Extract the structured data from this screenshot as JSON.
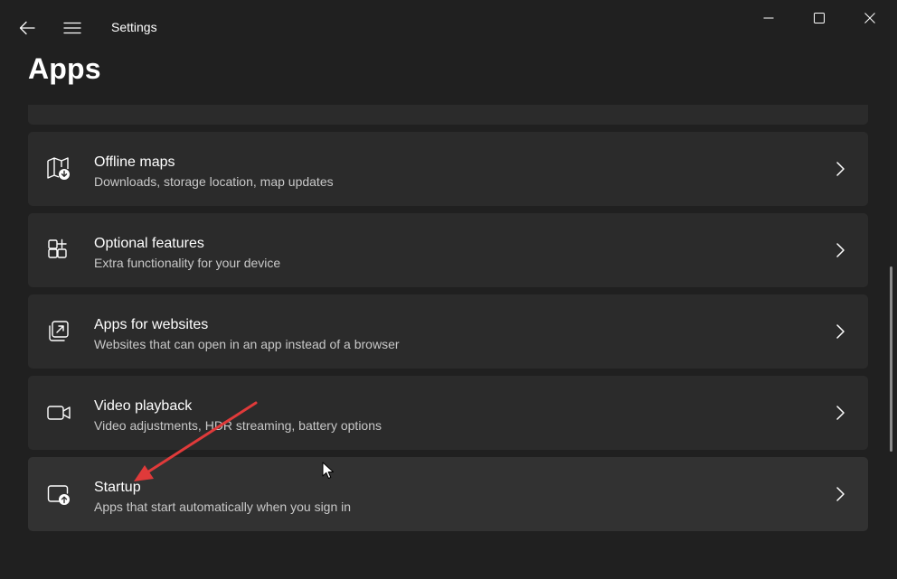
{
  "window": {
    "title": "Settings",
    "back_icon": "back-arrow-icon",
    "menu_icon": "hamburger-icon",
    "controls": [
      "minimize-icon",
      "maximize-icon",
      "close-icon"
    ]
  },
  "page": {
    "title": "Apps"
  },
  "items": [
    {
      "title": "Offline maps",
      "subtitle": "Downloads, storage location, map updates",
      "icon": "map-download-icon"
    },
    {
      "title": "Optional features",
      "subtitle": "Extra functionality for your device",
      "icon": "grid-add-icon"
    },
    {
      "title": "Apps for websites",
      "subtitle": "Websites that can open in an app instead of a browser",
      "icon": "open-in-app-icon"
    },
    {
      "title": "Video playback",
      "subtitle": "Video adjustments, HDR streaming, battery options",
      "icon": "video-camera-icon"
    },
    {
      "title": "Startup",
      "subtitle": "Apps that start automatically when you sign in",
      "icon": "startup-icon"
    }
  ],
  "colors": {
    "background": "#202020",
    "card": "#2b2b2b",
    "card_hover": "#323232",
    "annotation_arrow": "#e03a3a"
  }
}
